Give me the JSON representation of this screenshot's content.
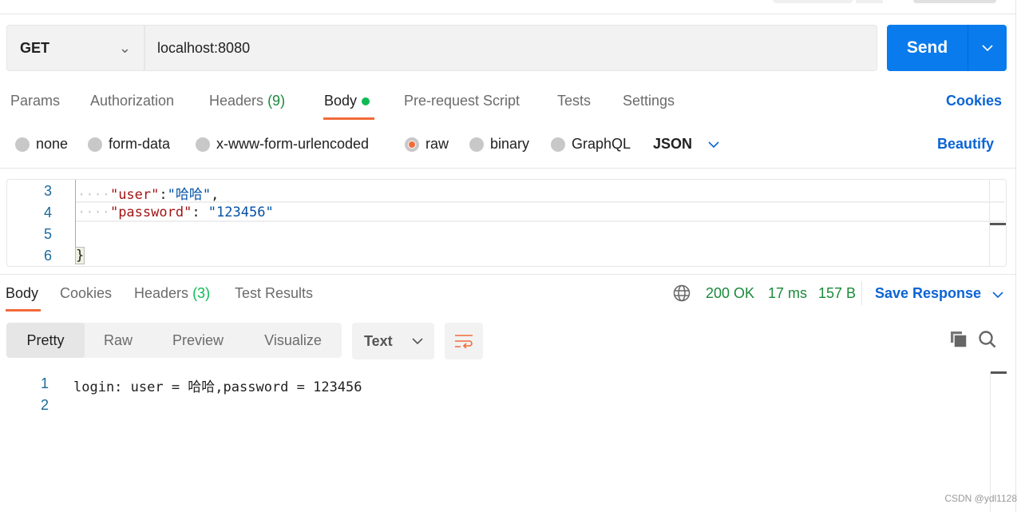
{
  "request": {
    "method": "GET",
    "url": "localhost:8080",
    "send_label": "Send"
  },
  "request_tabs": [
    {
      "label": "Params"
    },
    {
      "label": "Authorization"
    },
    {
      "label": "Headers",
      "count": "(9)"
    },
    {
      "label": "Body",
      "active": true
    },
    {
      "label": "Pre-request Script"
    },
    {
      "label": "Tests"
    },
    {
      "label": "Settings"
    }
  ],
  "cookies_link": "Cookies",
  "body_types": [
    {
      "label": "none"
    },
    {
      "label": "form-data"
    },
    {
      "label": "x-www-form-urlencoded"
    },
    {
      "label": "raw",
      "selected": true
    },
    {
      "label": "binary"
    },
    {
      "label": "GraphQL"
    }
  ],
  "raw_format": "JSON",
  "beautify_label": "Beautify",
  "editor": {
    "lines": [
      {
        "n": "3",
        "key": "\"user\"",
        "sep": ":",
        "val": "\"哈哈\"",
        "tail": ","
      },
      {
        "n": "4",
        "key": "\"password\"",
        "sep": ": ",
        "val": "\"123456\"",
        "tail": ""
      },
      {
        "n": "5"
      },
      {
        "n": "6",
        "brace": "}"
      }
    ]
  },
  "response_tabs": [
    {
      "label": "Body",
      "active": true
    },
    {
      "label": "Cookies"
    },
    {
      "label": "Headers",
      "count": "(3)"
    },
    {
      "label": "Test Results"
    }
  ],
  "response_status": {
    "code": "200 OK",
    "time": "17 ms",
    "size": "157 B"
  },
  "save_response_label": "Save Response",
  "view_modes": [
    "Pretty",
    "Raw",
    "Preview",
    "Visualize"
  ],
  "response_format": "Text",
  "response_lines": [
    {
      "n": "1",
      "text": "login: user = 哈哈,password = 123456"
    },
    {
      "n": "2",
      "text": ""
    }
  ],
  "watermark": "CSDN @ydl1128",
  "colors": {
    "accent": "#097bed",
    "active_tab": "#f26b3a",
    "status": "#1a8a3a",
    "link": "#0b64d4"
  }
}
